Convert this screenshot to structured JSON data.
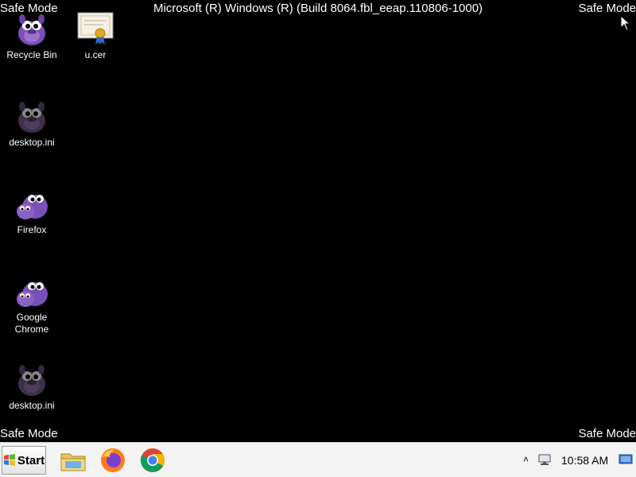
{
  "overlay": {
    "safe_mode_label": "Safe Mode",
    "build_string": "Microsoft (R) Windows (R) (Build 8064.fbl_eeap.110806-1000)"
  },
  "desktop_icons": [
    {
      "label": "Recycle Bin",
      "icon": "bonzi-recycle-bin-icon"
    },
    {
      "label": "u.cer",
      "icon": "certificate-icon"
    },
    {
      "label": "desktop.ini",
      "icon": "bonzi-dark-icon"
    },
    {
      "label": "Firefox",
      "icon": "bonzi-firefox-icon"
    },
    {
      "label": "Google Chrome",
      "icon": "bonzi-chrome-icon"
    },
    {
      "label": "desktop.ini",
      "icon": "bonzi-dark-icon"
    }
  ],
  "taskbar": {
    "start_label": "Start",
    "pinned": [
      "file-explorer-icon",
      "firefox-icon",
      "chrome-icon"
    ],
    "clock": "10:58 AM"
  },
  "colors": {
    "desktop_bg": "#000000",
    "taskbar_bg": "#f3f3f3",
    "bonzi_purple": "#7b4fb8"
  }
}
